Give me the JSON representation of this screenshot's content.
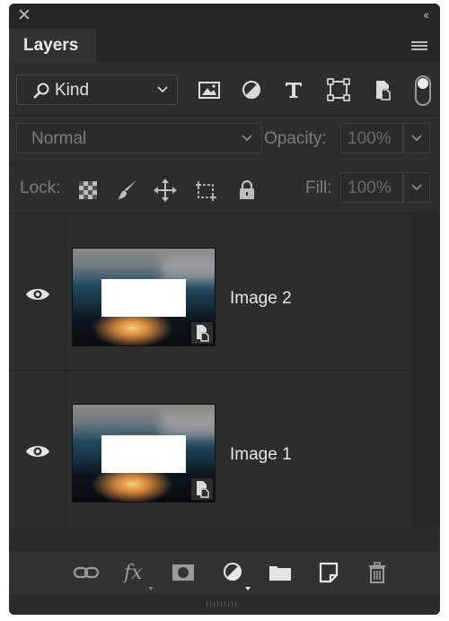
{
  "panel": {
    "tab_label": "Layers",
    "icons": {
      "close": "close-icon",
      "collapse": "double-chevron-left-icon",
      "menu": "hamburger-menu-icon"
    }
  },
  "filter": {
    "kind_label": "Kind",
    "buttons": [
      "pixel-filter-icon",
      "adjustment-filter-icon",
      "type-filter-icon",
      "shape-filter-icon",
      "smart-object-filter-icon"
    ],
    "toggle_on": true
  },
  "blend": {
    "mode": "Normal",
    "opacity_label": "Opacity:",
    "opacity_value": "100%"
  },
  "lock": {
    "label": "Lock:",
    "icons": [
      "lock-transparent-pixels-icon",
      "lock-image-pixels-icon",
      "lock-position-icon",
      "lock-artboard-icon",
      "lock-all-icon"
    ],
    "fill_label": "Fill:",
    "fill_value": "100%"
  },
  "layers": [
    {
      "name": "Image 2",
      "visible": true,
      "type": "smart-object"
    },
    {
      "name": "Image 1",
      "visible": true,
      "type": "smart-object"
    }
  ],
  "footer": {
    "fx_label": "fx",
    "icons": [
      "link-layers-icon",
      "fx-icon",
      "add-mask-icon",
      "adjustment-layer-icon",
      "new-group-icon",
      "new-layer-icon",
      "trash-icon"
    ]
  },
  "colors": {
    "panel": "#2d2d2d",
    "chrome": "#262626",
    "text": "#e6e6e6",
    "dim_text": "#7d7d7d"
  }
}
